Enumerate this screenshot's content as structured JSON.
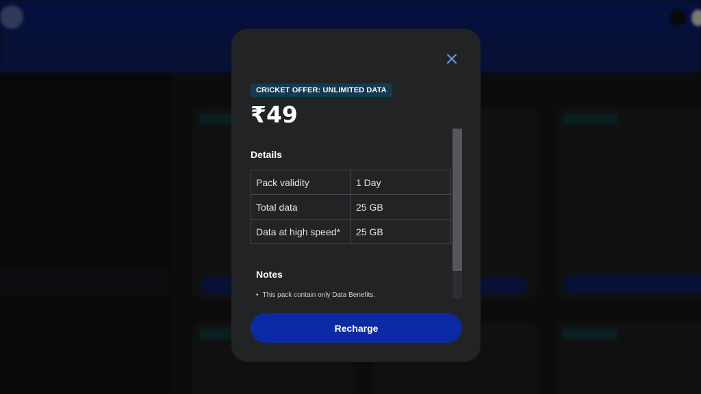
{
  "modal": {
    "offer_tag": "CRICKET OFFER: UNLIMITED DATA",
    "price": "₹49",
    "details_title": "Details",
    "details": [
      {
        "label": "Pack validity",
        "value": "1 Day"
      },
      {
        "label": "Total data",
        "value": "25 GB"
      },
      {
        "label": "Data at high speed*",
        "value": "25 GB"
      }
    ],
    "notes_title": "Notes",
    "notes": [
      "This pack contain only Data Benefits."
    ],
    "recharge_label": "Recharge",
    "close_icon": "close-icon"
  },
  "colors": {
    "accent": "#0c2aa3",
    "tag_bg": "#123a52",
    "modal_bg": "#222325",
    "close_icon": "#6f9be6"
  }
}
